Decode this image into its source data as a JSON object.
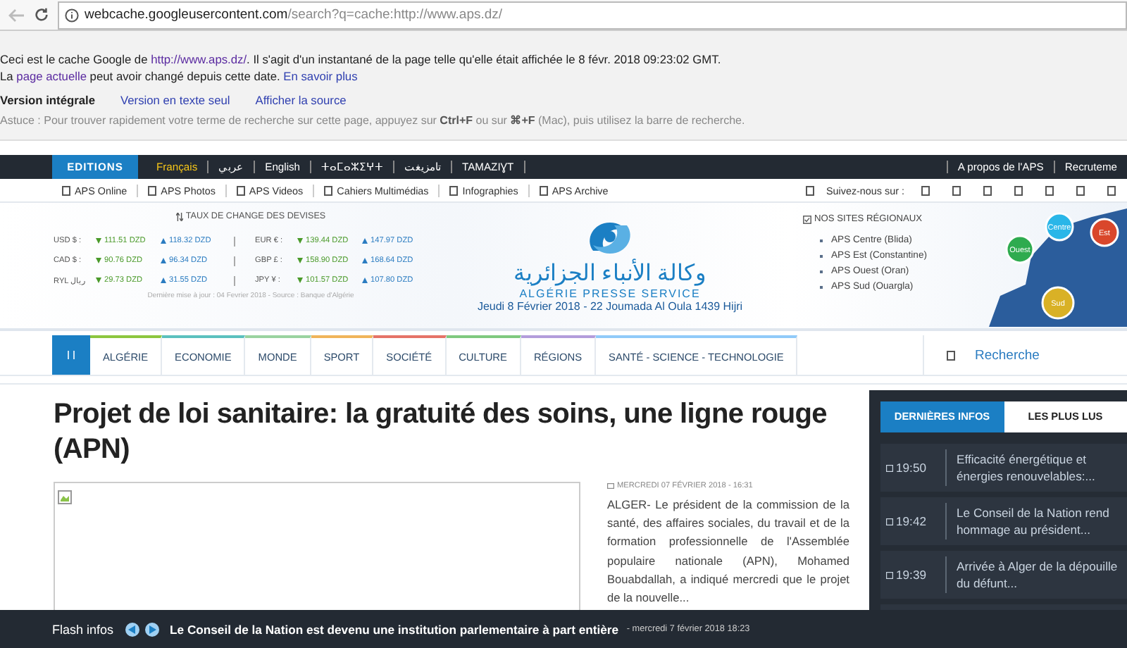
{
  "browser": {
    "url_host": "webcache.googleusercontent.com",
    "url_path": "/search?q=cache:http://www.aps.dz/"
  },
  "cache_notice": {
    "line1_before": "Ceci est le cache Google de ",
    "line1_link": "http://www.aps.dz/",
    "line1_after": ". Il s'agit d'un instantané de la page telle qu'elle était affichée le 8 févr. 2018 09:23:02 GMT.",
    "line2_before": "La ",
    "line2_link": "page actuelle",
    "line2_after": " peut avoir changé depuis cette date. ",
    "line2_more": "En savoir plus",
    "versions": [
      {
        "label": "Version intégrale",
        "selected": true
      },
      {
        "label": "Version en texte seul",
        "selected": false
      },
      {
        "label": "Afficher la source",
        "selected": false
      }
    ],
    "tip": "Astuce : Pour trouver rapidement votre terme de recherche sur cette page, appuyez sur **Ctrl+F** ou sur **⌘+F** (Mac), puis utilisez la barre de recherche."
  },
  "editions": {
    "label": "EDITIONS",
    "items": [
      {
        "label": "Français",
        "selected": true
      },
      {
        "label": "عربي",
        "selected": false
      },
      {
        "label": "English",
        "selected": false
      },
      {
        "label": "ⵜⴰⵎⴰⵣⵉⵖⵜ",
        "selected": false
      },
      {
        "label": "تامزيغت",
        "selected": false
      },
      {
        "label": "TAMAZIƔT",
        "selected": false
      }
    ],
    "right_links": [
      "A propos de l'APS",
      "Recruteme"
    ]
  },
  "services": {
    "links": [
      "APS Online",
      "APS Photos",
      "APS Videos",
      "Cahiers Multimédias",
      "Infographies",
      "APS Archive"
    ],
    "follow_label": "Suivez-nous sur :"
  },
  "exchange": {
    "title": "TAUX DE CHANGE DES DEVISES",
    "rates": [
      {
        "currency": "USD $ :",
        "buy": "111.51 DZD",
        "sell": "118.32 DZD"
      },
      {
        "currency": "EUR € :",
        "buy": "139.44 DZD",
        "sell": "147.97 DZD"
      },
      {
        "currency": "CAD $ :",
        "buy": "90.76 DZD",
        "sell": "96.34 DZD"
      },
      {
        "currency": "GBP £ :",
        "buy": "158.90 DZD",
        "sell": "168.64 DZD"
      },
      {
        "currency": "RYL ريال",
        "buy": "29.73 DZD",
        "sell": "31.55 DZD"
      },
      {
        "currency": "JPY ¥ :",
        "buy": "101.57 DZD",
        "sell": "107.80 DZD"
      }
    ],
    "note": "Dernière mise à jour : 04 Fevrier 2018 - Source : Banque d'Algérie"
  },
  "logo": {
    "arabic": "وكالة الأنباء الجزائرية",
    "name": "ALGÉRIE PRESSE SERVICE",
    "date": "Jeudi 8 Février 2018 - 22 Joumada Al Oula 1439 Hijri"
  },
  "regional": {
    "title": "NOS SITES RÉGIONAUX",
    "sites": [
      "APS Centre (Blida)",
      "APS Est (Constantine)",
      "APS Ouest (Oran)",
      "APS Sud (Ouargla)"
    ],
    "map_regions": [
      {
        "label": "Centre",
        "color": "#29b6e8"
      },
      {
        "label": "Est",
        "color": "#d9472b"
      },
      {
        "label": "Ouest",
        "color": "#2eab4f"
      },
      {
        "label": "Sud",
        "color": "#d9b126"
      }
    ]
  },
  "menu": {
    "items": [
      {
        "label": "ALGÉRIE",
        "color": "#8cc63f"
      },
      {
        "label": "ECONOMIE",
        "color": "#5bc0be"
      },
      {
        "label": "MONDE",
        "color": "#9ad3a0"
      },
      {
        "label": "SPORT",
        "color": "#f0b45a"
      },
      {
        "label": "SOCIÉTÉ",
        "color": "#e57368"
      },
      {
        "label": "CULTURE",
        "color": "#7fc97f"
      },
      {
        "label": "RÉGIONS",
        "color": "#b39ddb"
      },
      {
        "label": "SANTÉ - SCIENCE - TECHNOLOGIE",
        "color": "#90caf9"
      }
    ],
    "search_label": "Recherche"
  },
  "article": {
    "title": "Projet de loi sanitaire: la gratuité des soins, une ligne rouge (APN)",
    "date": "MERCREDI 07 FÉVRIER 2018 - 16:31",
    "summary": "ALGER- Le président de la commission de la santé, des affaires sociales, du travail et de la formation professionnelle de l'Assemblée populaire nationale (APN), Mohamed Bouabdallah, a indiqué mercredi que le projet de la nouvelle..."
  },
  "sidebar": {
    "tabs": [
      {
        "label": "DERNIÈRES INFOS",
        "selected": true
      },
      {
        "label": "LES PLUS LUS",
        "selected": false
      }
    ],
    "news": [
      {
        "time": "19:50",
        "title": "Efficacité énergétique et énergies renouvelables:..."
      },
      {
        "time": "19:42",
        "title": "Le Conseil de la Nation rend hommage au président..."
      },
      {
        "time": "19:39",
        "title": "Arrivée à Alger de la dépouille du défunt..."
      }
    ]
  },
  "flash": {
    "label": "Flash infos",
    "headline": "Le Conseil de la Nation est devenu une institution parlementaire à part entière",
    "date": " - mercredi 7 février 2018 18:23"
  }
}
